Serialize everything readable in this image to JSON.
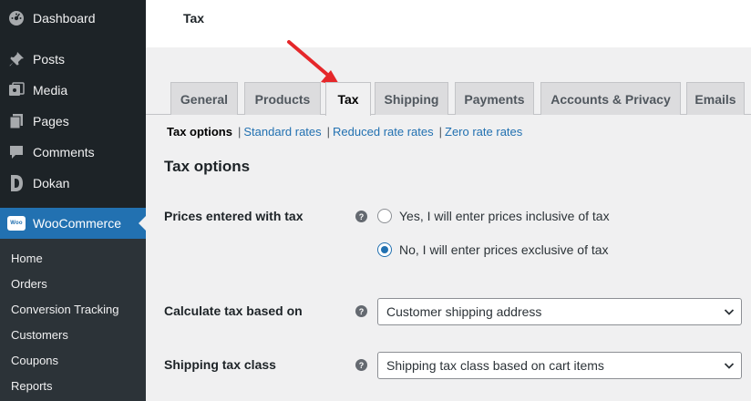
{
  "sidebar": {
    "items": [
      {
        "label": "Dashboard",
        "icon": "dashboard-icon"
      },
      {
        "label": "Posts",
        "icon": "pin-icon"
      },
      {
        "label": "Media",
        "icon": "media-icon"
      },
      {
        "label": "Pages",
        "icon": "pages-icon"
      },
      {
        "label": "Comments",
        "icon": "comment-icon"
      },
      {
        "label": "Dokan",
        "icon": "dokan-icon"
      },
      {
        "label": "WooCommerce",
        "icon": "woocommerce-icon",
        "active": true
      }
    ],
    "woo_badge": "Woo",
    "submenu": [
      "Home",
      "Orders",
      "Conversion Tracking",
      "Customers",
      "Coupons",
      "Reports"
    ]
  },
  "header": {
    "title": "Tax"
  },
  "tabs": [
    "General",
    "Products",
    "Tax",
    "Shipping",
    "Payments",
    "Accounts & Privacy",
    "Emails"
  ],
  "active_tab": "Tax",
  "subnav": {
    "current": "Tax options",
    "links": [
      "Standard rates",
      "Reduced rate rates",
      "Zero rate rates"
    ],
    "separator": "|"
  },
  "section_title": "Tax options",
  "settings": {
    "prices_entered": {
      "label": "Prices entered with tax",
      "options": [
        {
          "label": "Yes, I will enter prices inclusive of tax",
          "checked": false
        },
        {
          "label": "No, I will enter prices exclusive of tax",
          "checked": true
        }
      ]
    },
    "calculate_based_on": {
      "label": "Calculate tax based on",
      "value": "Customer shipping address"
    },
    "shipping_tax_class": {
      "label": "Shipping tax class",
      "value": "Shipping tax class based on cart items"
    }
  },
  "help_glyph": "?",
  "colors": {
    "sidebar_bg": "#1d2327",
    "submenu_bg": "#2c3338",
    "accent": "#2271b1",
    "annotation_arrow": "#e5272a"
  }
}
